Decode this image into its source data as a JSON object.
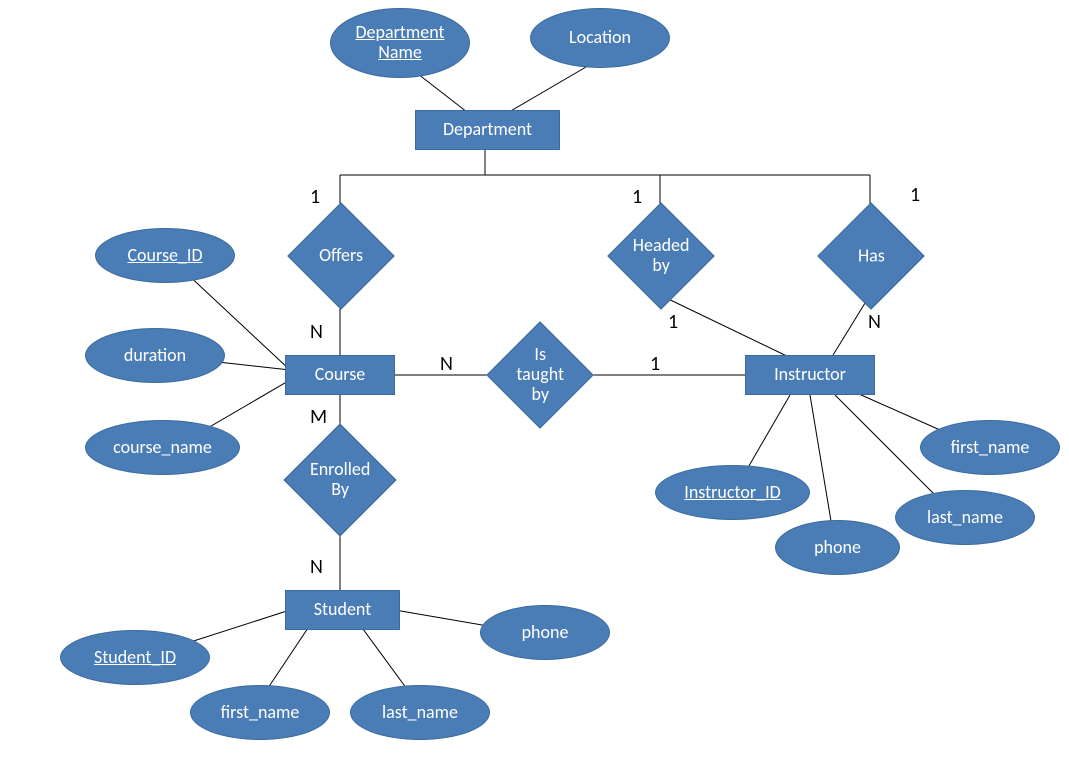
{
  "entities": {
    "department": "Department",
    "course": "Course",
    "instructor": "Instructor",
    "student": "Student"
  },
  "relationships": {
    "offers": "Offers",
    "headed_by": "Headed by",
    "has": "Has",
    "is_taught_by": "Is taught by",
    "enrolled_by": "Enrolled By"
  },
  "attributes": {
    "department_name": "Department Name",
    "location": "Location",
    "course_id": "Course_ID",
    "duration": "duration",
    "course_name": "course_name",
    "instructor_id": "Instructor_ID",
    "instr_first_name": "first_name",
    "instr_last_name": "last_name",
    "instr_phone": "phone",
    "student_id": "Student_ID",
    "stu_first_name": "first_name",
    "stu_last_name": "last_name",
    "stu_phone": "phone"
  },
  "cardinalities": {
    "offers_top": "1",
    "offers_bottom": "N",
    "headed_top": "1",
    "headed_bottom": "1",
    "has_top": "1",
    "has_bottom": "N",
    "taught_left": "N",
    "taught_right": "1",
    "enrolled_top": "M",
    "enrolled_bottom": "N"
  }
}
